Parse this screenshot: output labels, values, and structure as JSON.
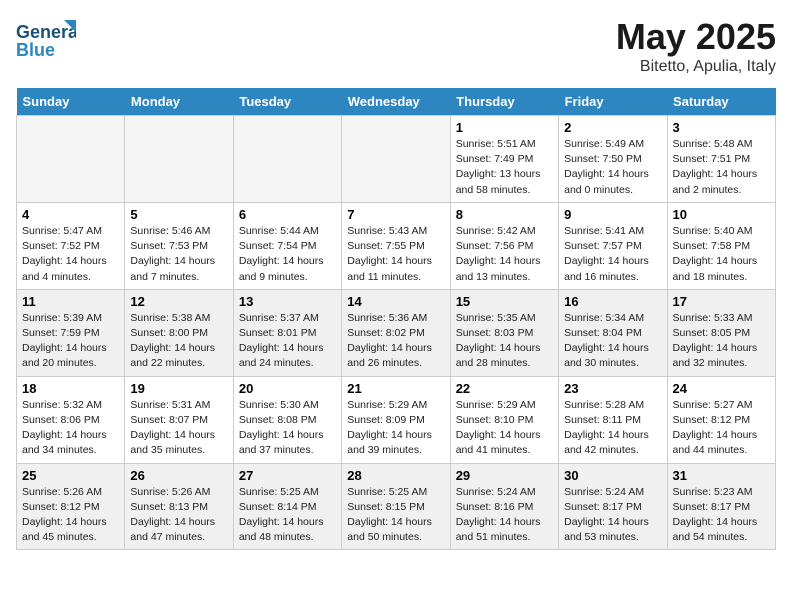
{
  "header": {
    "logo_line1": "General",
    "logo_line2": "Blue",
    "month_year": "May 2025",
    "location": "Bitetto, Apulia, Italy"
  },
  "days_of_week": [
    "Sunday",
    "Monday",
    "Tuesday",
    "Wednesday",
    "Thursday",
    "Friday",
    "Saturday"
  ],
  "weeks": [
    [
      {
        "day": "",
        "empty": true
      },
      {
        "day": "",
        "empty": true
      },
      {
        "day": "",
        "empty": true
      },
      {
        "day": "",
        "empty": true
      },
      {
        "day": "1",
        "sunrise": "Sunrise: 5:51 AM",
        "sunset": "Sunset: 7:49 PM",
        "daylight": "Daylight: 13 hours and 58 minutes."
      },
      {
        "day": "2",
        "sunrise": "Sunrise: 5:49 AM",
        "sunset": "Sunset: 7:50 PM",
        "daylight": "Daylight: 14 hours and 0 minutes."
      },
      {
        "day": "3",
        "sunrise": "Sunrise: 5:48 AM",
        "sunset": "Sunset: 7:51 PM",
        "daylight": "Daylight: 14 hours and 2 minutes."
      }
    ],
    [
      {
        "day": "4",
        "sunrise": "Sunrise: 5:47 AM",
        "sunset": "Sunset: 7:52 PM",
        "daylight": "Daylight: 14 hours and 4 minutes."
      },
      {
        "day": "5",
        "sunrise": "Sunrise: 5:46 AM",
        "sunset": "Sunset: 7:53 PM",
        "daylight": "Daylight: 14 hours and 7 minutes."
      },
      {
        "day": "6",
        "sunrise": "Sunrise: 5:44 AM",
        "sunset": "Sunset: 7:54 PM",
        "daylight": "Daylight: 14 hours and 9 minutes."
      },
      {
        "day": "7",
        "sunrise": "Sunrise: 5:43 AM",
        "sunset": "Sunset: 7:55 PM",
        "daylight": "Daylight: 14 hours and 11 minutes."
      },
      {
        "day": "8",
        "sunrise": "Sunrise: 5:42 AM",
        "sunset": "Sunset: 7:56 PM",
        "daylight": "Daylight: 14 hours and 13 minutes."
      },
      {
        "day": "9",
        "sunrise": "Sunrise: 5:41 AM",
        "sunset": "Sunset: 7:57 PM",
        "daylight": "Daylight: 14 hours and 16 minutes."
      },
      {
        "day": "10",
        "sunrise": "Sunrise: 5:40 AM",
        "sunset": "Sunset: 7:58 PM",
        "daylight": "Daylight: 14 hours and 18 minutes."
      }
    ],
    [
      {
        "day": "11",
        "sunrise": "Sunrise: 5:39 AM",
        "sunset": "Sunset: 7:59 PM",
        "daylight": "Daylight: 14 hours and 20 minutes."
      },
      {
        "day": "12",
        "sunrise": "Sunrise: 5:38 AM",
        "sunset": "Sunset: 8:00 PM",
        "daylight": "Daylight: 14 hours and 22 minutes."
      },
      {
        "day": "13",
        "sunrise": "Sunrise: 5:37 AM",
        "sunset": "Sunset: 8:01 PM",
        "daylight": "Daylight: 14 hours and 24 minutes."
      },
      {
        "day": "14",
        "sunrise": "Sunrise: 5:36 AM",
        "sunset": "Sunset: 8:02 PM",
        "daylight": "Daylight: 14 hours and 26 minutes."
      },
      {
        "day": "15",
        "sunrise": "Sunrise: 5:35 AM",
        "sunset": "Sunset: 8:03 PM",
        "daylight": "Daylight: 14 hours and 28 minutes."
      },
      {
        "day": "16",
        "sunrise": "Sunrise: 5:34 AM",
        "sunset": "Sunset: 8:04 PM",
        "daylight": "Daylight: 14 hours and 30 minutes."
      },
      {
        "day": "17",
        "sunrise": "Sunrise: 5:33 AM",
        "sunset": "Sunset: 8:05 PM",
        "daylight": "Daylight: 14 hours and 32 minutes."
      }
    ],
    [
      {
        "day": "18",
        "sunrise": "Sunrise: 5:32 AM",
        "sunset": "Sunset: 8:06 PM",
        "daylight": "Daylight: 14 hours and 34 minutes."
      },
      {
        "day": "19",
        "sunrise": "Sunrise: 5:31 AM",
        "sunset": "Sunset: 8:07 PM",
        "daylight": "Daylight: 14 hours and 35 minutes."
      },
      {
        "day": "20",
        "sunrise": "Sunrise: 5:30 AM",
        "sunset": "Sunset: 8:08 PM",
        "daylight": "Daylight: 14 hours and 37 minutes."
      },
      {
        "day": "21",
        "sunrise": "Sunrise: 5:29 AM",
        "sunset": "Sunset: 8:09 PM",
        "daylight": "Daylight: 14 hours and 39 minutes."
      },
      {
        "day": "22",
        "sunrise": "Sunrise: 5:29 AM",
        "sunset": "Sunset: 8:10 PM",
        "daylight": "Daylight: 14 hours and 41 minutes."
      },
      {
        "day": "23",
        "sunrise": "Sunrise: 5:28 AM",
        "sunset": "Sunset: 8:11 PM",
        "daylight": "Daylight: 14 hours and 42 minutes."
      },
      {
        "day": "24",
        "sunrise": "Sunrise: 5:27 AM",
        "sunset": "Sunset: 8:12 PM",
        "daylight": "Daylight: 14 hours and 44 minutes."
      }
    ],
    [
      {
        "day": "25",
        "sunrise": "Sunrise: 5:26 AM",
        "sunset": "Sunset: 8:12 PM",
        "daylight": "Daylight: 14 hours and 45 minutes."
      },
      {
        "day": "26",
        "sunrise": "Sunrise: 5:26 AM",
        "sunset": "Sunset: 8:13 PM",
        "daylight": "Daylight: 14 hours and 47 minutes."
      },
      {
        "day": "27",
        "sunrise": "Sunrise: 5:25 AM",
        "sunset": "Sunset: 8:14 PM",
        "daylight": "Daylight: 14 hours and 48 minutes."
      },
      {
        "day": "28",
        "sunrise": "Sunrise: 5:25 AM",
        "sunset": "Sunset: 8:15 PM",
        "daylight": "Daylight: 14 hours and 50 minutes."
      },
      {
        "day": "29",
        "sunrise": "Sunrise: 5:24 AM",
        "sunset": "Sunset: 8:16 PM",
        "daylight": "Daylight: 14 hours and 51 minutes."
      },
      {
        "day": "30",
        "sunrise": "Sunrise: 5:24 AM",
        "sunset": "Sunset: 8:17 PM",
        "daylight": "Daylight: 14 hours and 53 minutes."
      },
      {
        "day": "31",
        "sunrise": "Sunrise: 5:23 AM",
        "sunset": "Sunset: 8:17 PM",
        "daylight": "Daylight: 14 hours and 54 minutes."
      }
    ]
  ]
}
